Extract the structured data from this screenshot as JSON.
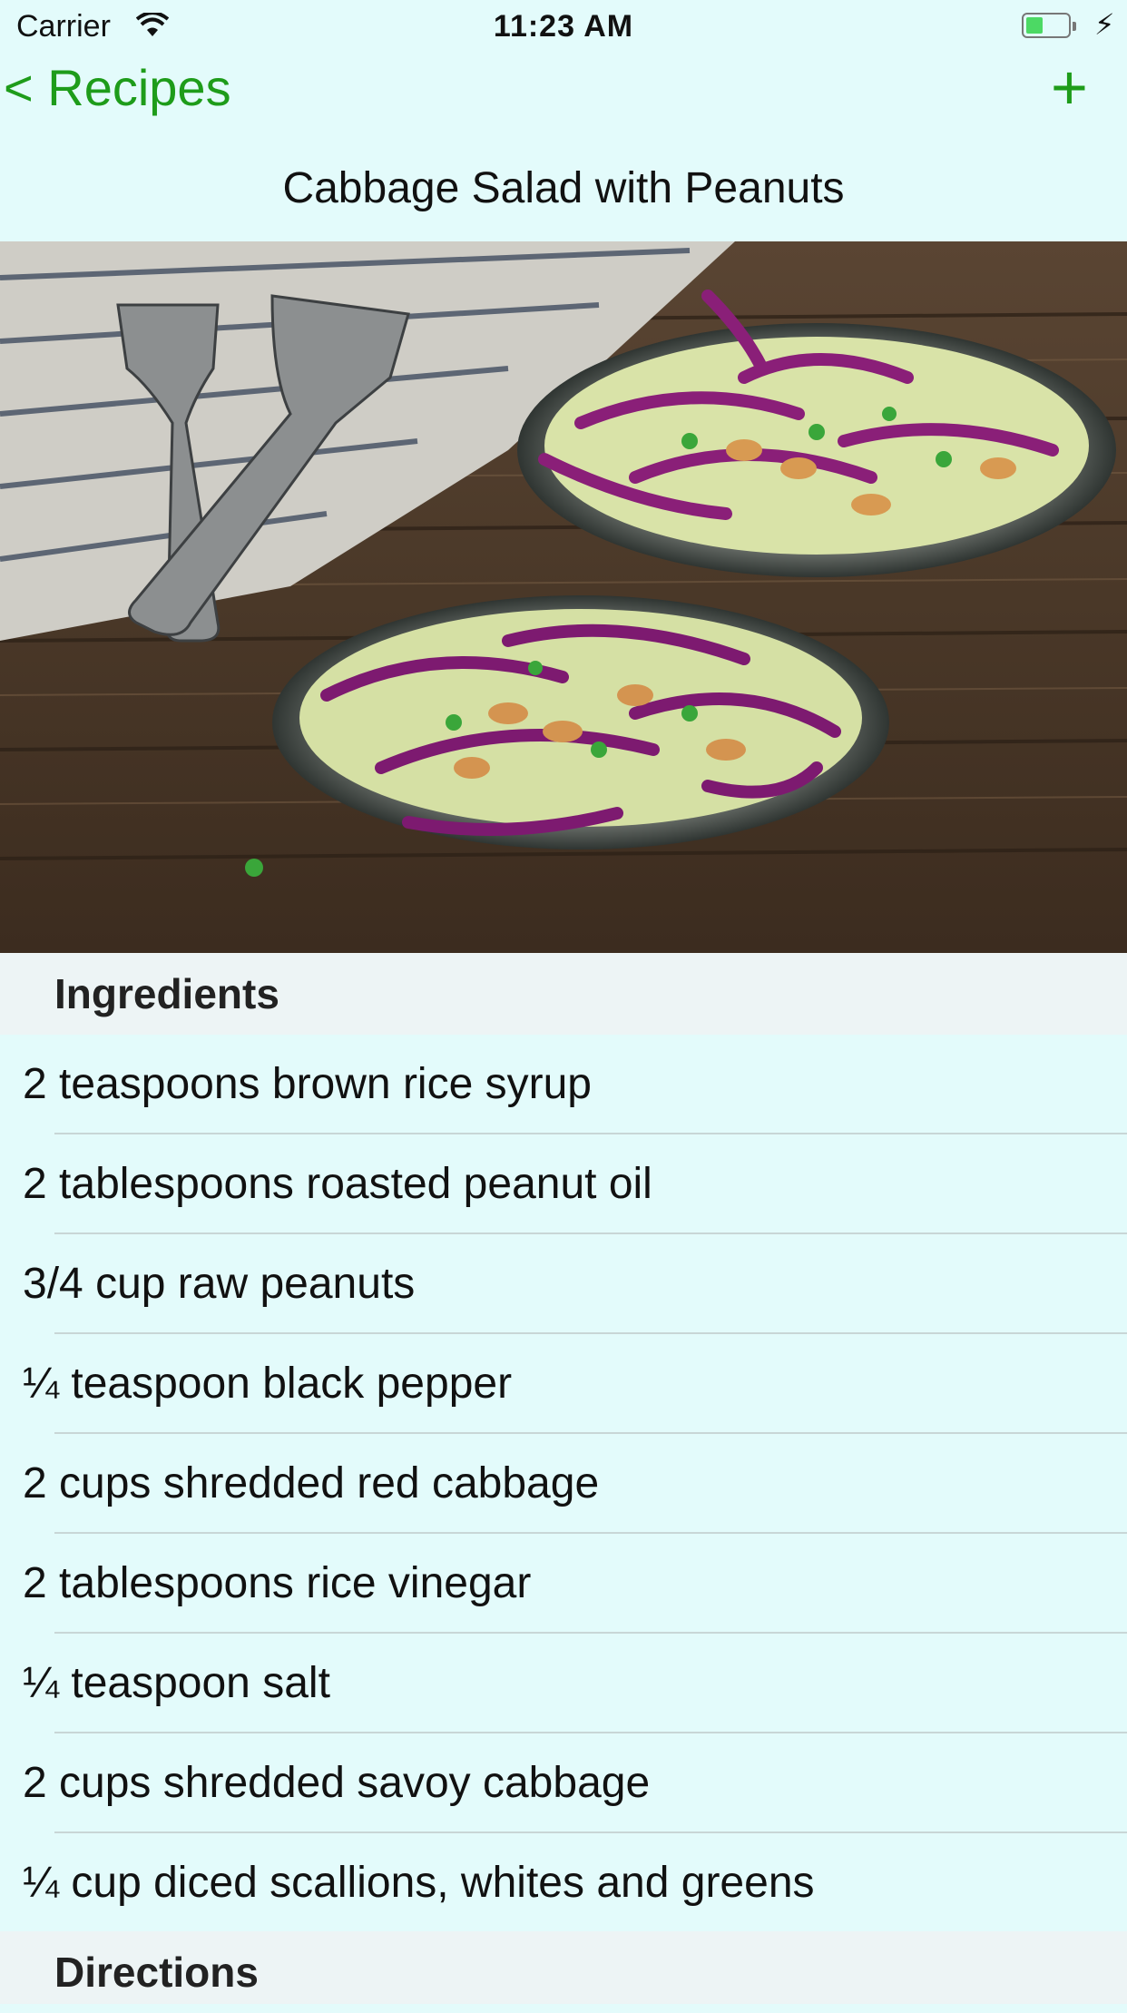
{
  "status_bar": {
    "carrier": "Carrier",
    "time": "11:23 AM",
    "battery_level": 0.4
  },
  "nav": {
    "back_label": "< Recipes",
    "add_label": "+",
    "title": "Cabbage Salad with Peanuts"
  },
  "colors": {
    "accent": "#1e9c1a",
    "background": "#e3fbfb",
    "section_header_bg": "#edf4f5"
  },
  "ingredients": {
    "header": "Ingredients",
    "items": [
      "2 teaspoons brown rice syrup",
      "2 tablespoons roasted peanut oil",
      "3/4 cup raw peanuts",
      "¼ teaspoon black pepper",
      "2 cups shredded red cabbage",
      "2 tablespoons rice vinegar",
      "¼ teaspoon salt",
      "2 cups shredded savoy cabbage",
      "¼ cup diced scallions, whites and greens"
    ]
  },
  "directions": {
    "header": "Directions"
  }
}
